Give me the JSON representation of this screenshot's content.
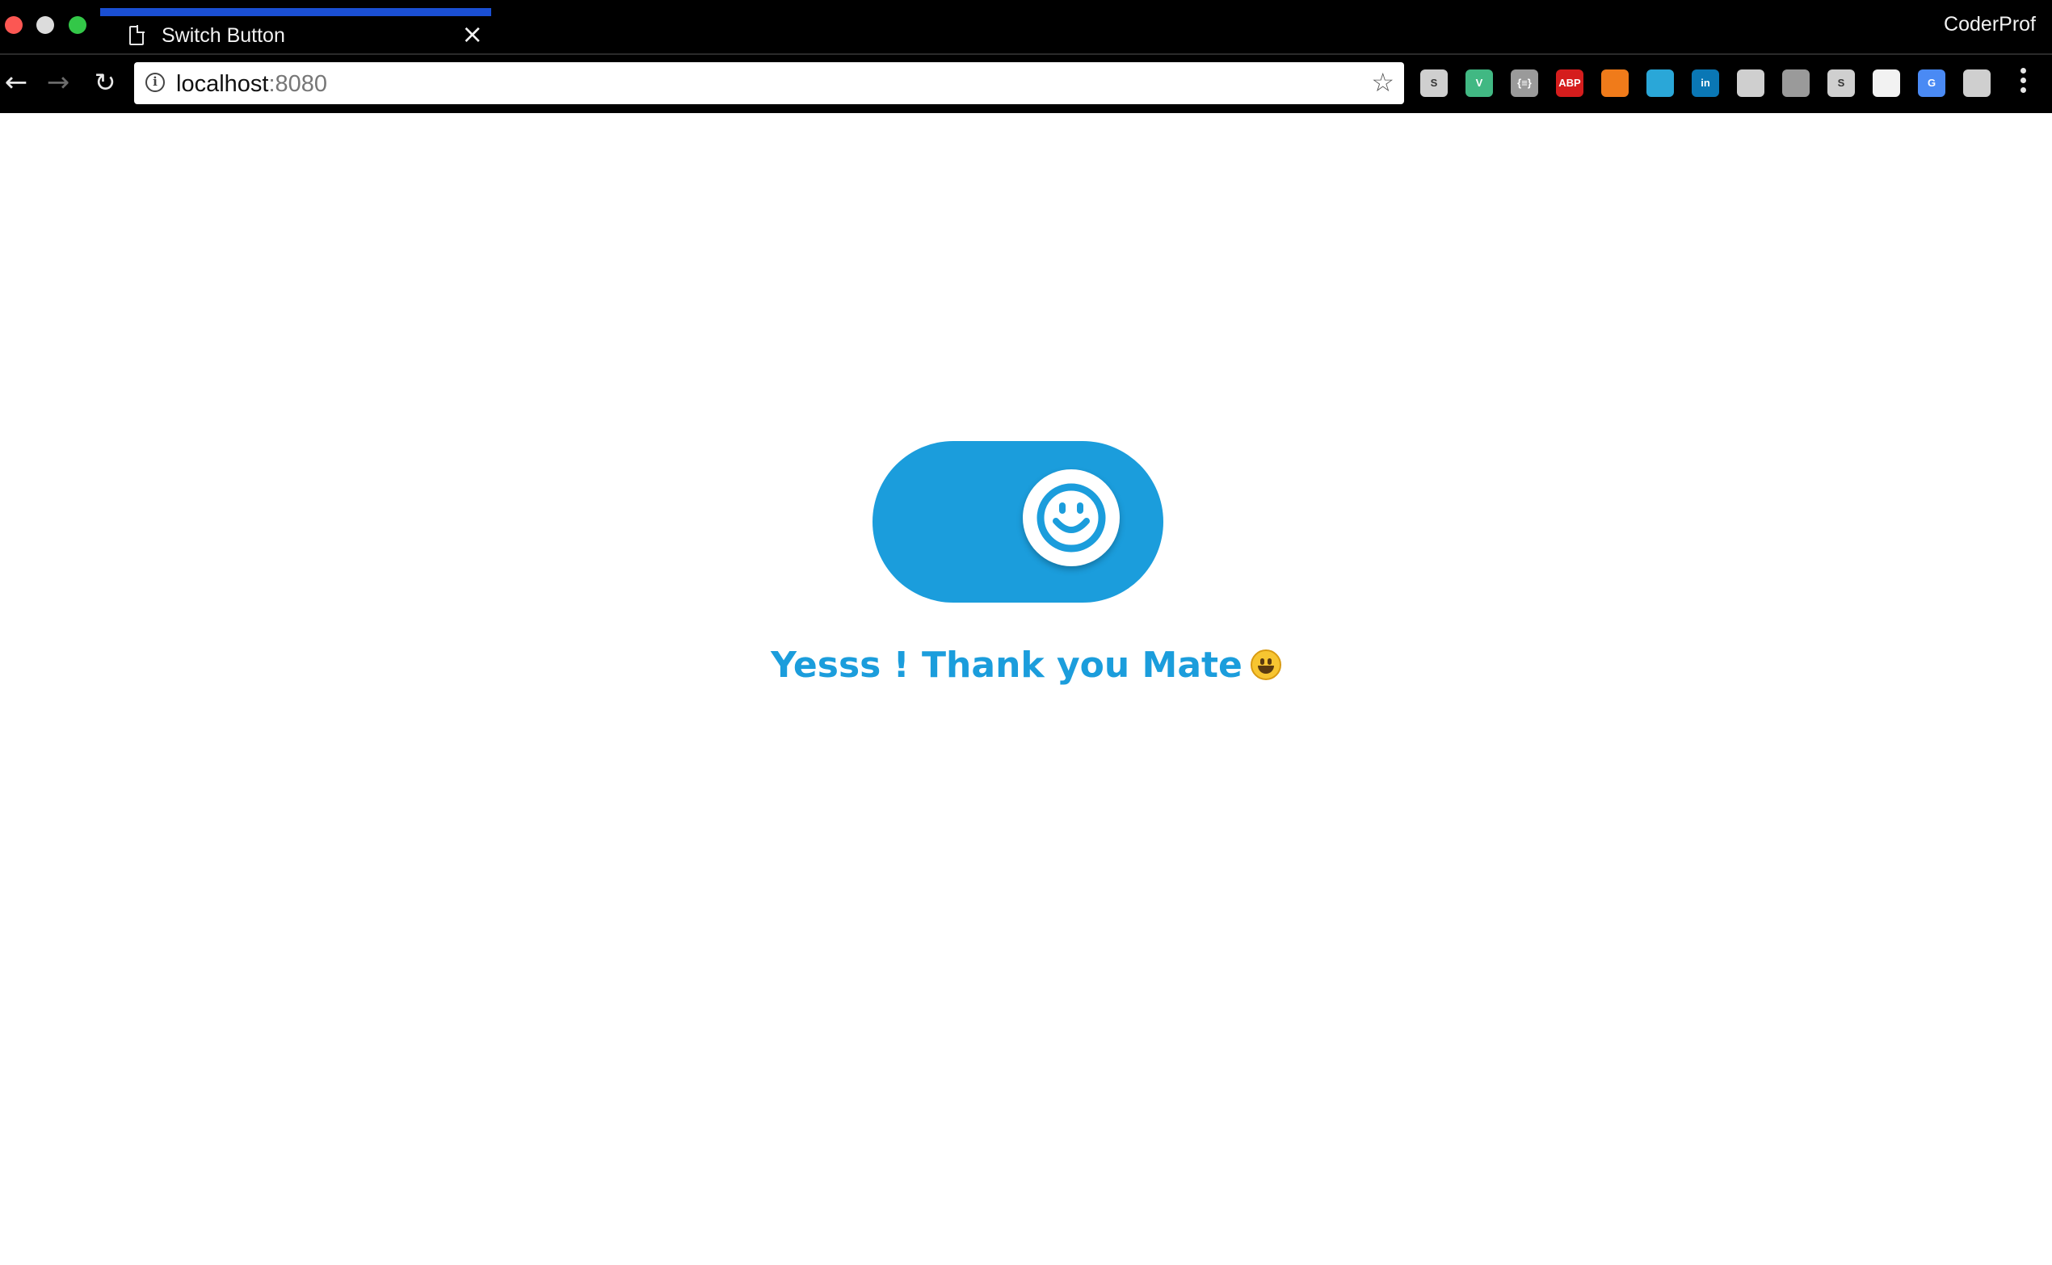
{
  "browser": {
    "tab": {
      "title": "Switch Button"
    },
    "profile_name": "CoderProf",
    "url": {
      "host": "localhost",
      "port": ":8080"
    },
    "extensions": [
      {
        "name": "skype-extension-icon",
        "label": "S",
        "color": "#cfcfcf"
      },
      {
        "name": "vue-devtools-icon",
        "label": "V",
        "color": "#41b883"
      },
      {
        "name": "json-viewer-icon",
        "label": "{≡}",
        "color": "#9a9a9a"
      },
      {
        "name": "adblock-plus-icon",
        "label": "ABP",
        "color": "#d51d1d"
      },
      {
        "name": "analytics-extension-icon",
        "label": "",
        "color": "#f07b1a"
      },
      {
        "name": "wappalyzer-icon",
        "label": "",
        "color": "#2aa7d8"
      },
      {
        "name": "linkedin-icon",
        "label": "in",
        "color": "#0a77b5"
      },
      {
        "name": "page-extension-icon",
        "label": "",
        "color": "#cfcfcf"
      },
      {
        "name": "download-extension-icon",
        "label": "",
        "color": "#9a9a9a"
      },
      {
        "name": "s-extension-icon",
        "label": "S",
        "color": "#cfcfcf"
      },
      {
        "name": "calendar-extension-icon",
        "label": "",
        "color": "#f2f2f2"
      },
      {
        "name": "google-translate-icon",
        "label": "G",
        "color": "#4a8af4"
      },
      {
        "name": "color-picker-icon",
        "label": "",
        "color": "#cfcfcf"
      }
    ]
  },
  "page": {
    "switch": {
      "state": "on",
      "color": "#1b9ddc",
      "icon": "smiley-face-icon"
    },
    "message": "Yesss ! Thank you Mate",
    "message_emoji": "grinning-face-emoji"
  }
}
